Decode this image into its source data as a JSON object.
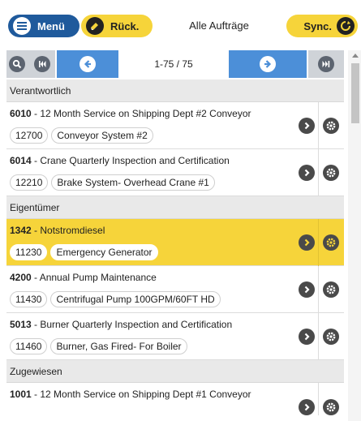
{
  "header": {
    "menu_label": "Menü",
    "back_label": "Rück.",
    "title": "Alle Aufträge",
    "sync_label": "Sync."
  },
  "nav": {
    "pages": "1-75 / 75"
  },
  "sections": {
    "responsible": "Verantwortlich",
    "owner": "Eigentümer",
    "assigned": "Zugewiesen"
  },
  "items": [
    {
      "id": "6010",
      "desc": " - 12 Month Service on Shipping Dept #2 Conveyor",
      "asset": "12700",
      "asset_name": "Conveyor System #2"
    },
    {
      "id": "6014",
      "desc": " - Crane Quarterly Inspection and Certification",
      "asset": "12210",
      "asset_name": "Brake System- Overhead Crane #1"
    },
    {
      "id": "1342",
      "desc": " - Notstromdiesel",
      "asset": "11230",
      "asset_name": "Emergency Generator"
    },
    {
      "id": "4200",
      "desc": " - Annual Pump Maintenance",
      "asset": "11430",
      "asset_name": "Centrifugal Pump 100GPM/60FT HD"
    },
    {
      "id": "5013",
      "desc": " - Burner Quarterly Inspection and Certification",
      "asset": "11460",
      "asset_name": "Burner, Gas Fired- For Boiler"
    },
    {
      "id": "1001",
      "desc": " - 12 Month Service on Shipping Dept #1 Conveyor"
    }
  ],
  "colors": {
    "primary": "#1f5a9c",
    "accent": "#f6d43a",
    "nav_blue": "#4c8fd8"
  }
}
